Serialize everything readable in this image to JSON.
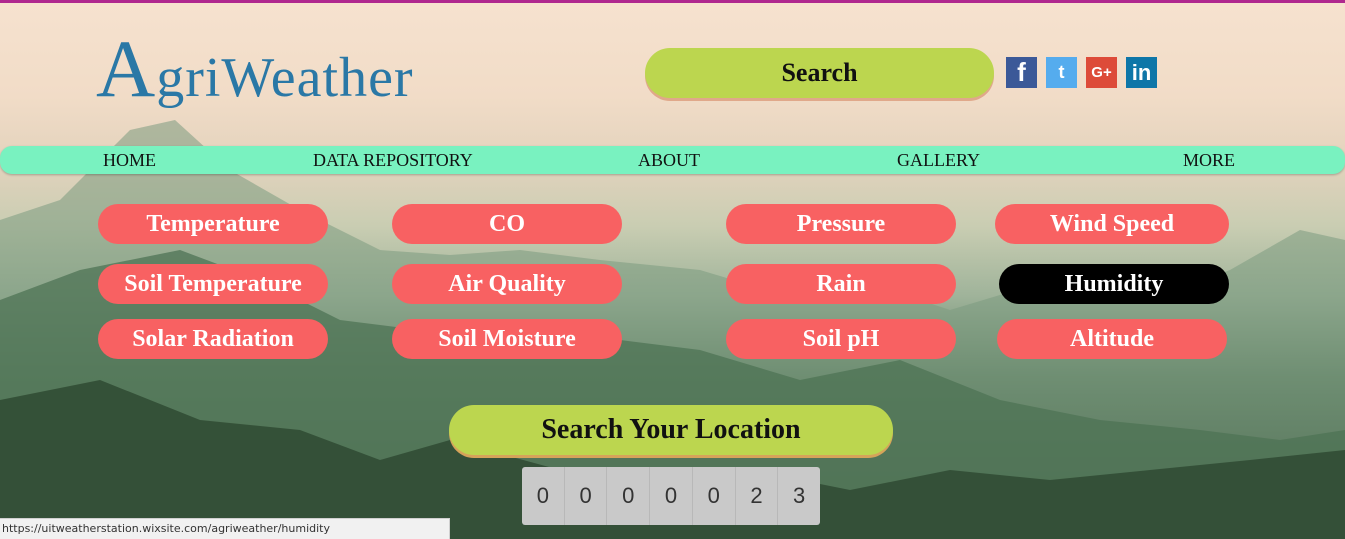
{
  "header": {
    "logo_initial": "A",
    "logo_rest": "griWeather",
    "search_label": "Search",
    "social": [
      "facebook-icon",
      "twitter-icon",
      "google-plus-icon",
      "linkedin-icon"
    ],
    "social_glyphs": {
      "fb": "f",
      "tw": "t",
      "gp": "G+",
      "li": "in"
    }
  },
  "nav": [
    "HOME",
    "DATA REPOSITORY",
    "ABOUT",
    "GALLERY",
    "MORE"
  ],
  "sensors": [
    "Temperature",
    "CO",
    "Pressure",
    "Wind Speed",
    "Soil Temperature",
    "Air Quality",
    "Rain",
    "Humidity",
    "Solar Radiation",
    "Soil Moisture",
    "Soil pH",
    "Altitude"
  ],
  "active_sensor": "Humidity",
  "location_button": "Search Your Location",
  "counter_digits": [
    "0",
    "0",
    "0",
    "0",
    "0",
    "2",
    "3"
  ],
  "status_url": "https://uitweatherstation.wixsite.com/agriweather/humidity",
  "colors": {
    "accent_green": "#bcd64f",
    "nav_bg": "#79f2c0",
    "pill_red": "#f86162",
    "pill_active": "#000000",
    "logo_blue": "#2a78a6"
  }
}
